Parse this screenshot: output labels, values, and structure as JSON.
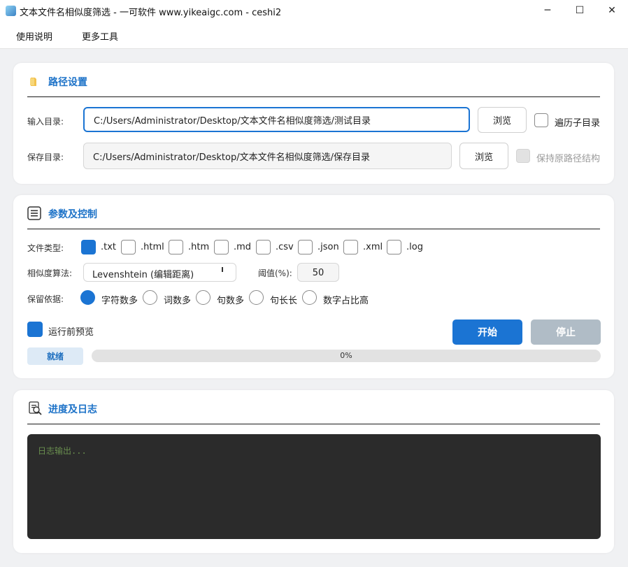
{
  "window": {
    "title": "文本文件名相似度筛选 - 一可软件 www.yikeaigc.com - ceshi2",
    "minimize": "─",
    "maximize": "☐",
    "close": "✕"
  },
  "menu": [
    "使用说明",
    "更多工具"
  ],
  "path_section": {
    "title": "路径设置",
    "input_label": "输入目录:",
    "input_value": "C:/Users/Administrator/Desktop/文本文件名相似度筛选/测试目录",
    "browse_label": "浏览",
    "recurse_label": "遍历子目录",
    "recurse_checked": false,
    "save_label": "保存目录:",
    "save_value": "C:/Users/Administrator/Desktop/文本文件名相似度筛选/保存目录",
    "keep_structure_label": "保持原路径结构",
    "keep_structure_enabled": false
  },
  "params_section": {
    "title": "参数及控制",
    "filetype_label": "文件类型:",
    "filetypes": [
      {
        "label": ".txt",
        "checked": true
      },
      {
        "label": ".html",
        "checked": false
      },
      {
        "label": ".htm",
        "checked": false
      },
      {
        "label": ".md",
        "checked": false
      },
      {
        "label": ".csv",
        "checked": false
      },
      {
        "label": ".json",
        "checked": false
      },
      {
        "label": ".xml",
        "checked": false
      },
      {
        "label": ".log",
        "checked": false
      }
    ],
    "algo_label": "相似度算法:",
    "algo_value": "Levenshtein (编辑距离)",
    "threshold_label": "阈值(%):",
    "threshold_value": "50",
    "keep_label": "保留依据:",
    "keep_options": [
      {
        "label": "字符数多",
        "selected": true
      },
      {
        "label": "词数多",
        "selected": false
      },
      {
        "label": "句数多",
        "selected": false
      },
      {
        "label": "句长长",
        "selected": false
      },
      {
        "label": "数字占比高",
        "selected": false
      }
    ],
    "preview_label": "运行前预览",
    "preview_checked": true,
    "start_label": "开始",
    "stop_label": "停止",
    "status_label": "就绪",
    "progress_text": "0%",
    "progress_value": 0
  },
  "log_section": {
    "title": "进度及日志",
    "placeholder": "日志输出..."
  },
  "colors": {
    "accent": "#1b74d3",
    "title_blue": "#1e73c8",
    "stop_disabled": "#b0bcc6",
    "log_bg": "#2b2b2b",
    "log_text": "#6a8f4f",
    "status_bg": "#ddeaf6"
  }
}
